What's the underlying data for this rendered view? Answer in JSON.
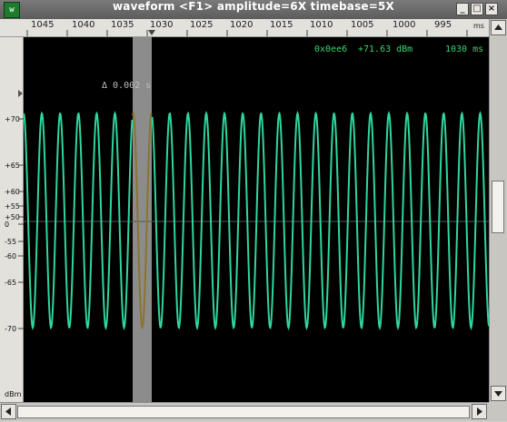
{
  "window": {
    "title": "waveform  <F1> amplitude=6X timebase=5X",
    "app_icon_text": "w"
  },
  "ruler": {
    "ticks": [
      {
        "label": "1045"
      },
      {
        "label": "1040"
      },
      {
        "label": "1035"
      },
      {
        "label": "1030"
      },
      {
        "label": "1025"
      },
      {
        "label": "1020"
      },
      {
        "label": "1015"
      },
      {
        "label": "1010"
      },
      {
        "label": "1005"
      },
      {
        "label": "1000"
      },
      {
        "label": "995"
      }
    ],
    "unit": "ms"
  },
  "yaxis": {
    "labels": [
      "+70",
      "+65",
      "+60",
      "+55",
      "+50",
      "0",
      "-55",
      "-60",
      "-65",
      "-70"
    ],
    "unit": "dBm"
  },
  "readouts": {
    "address": "0x0ee6",
    "level": "+71.63 dBm",
    "time": "1030 ms"
  },
  "delta": {
    "label": "Δ 0.002 s"
  },
  "colors": {
    "wave": "#2fd6a0",
    "wave_selected": "#8a7430",
    "selection": "#8c8c8c",
    "background": "#000000",
    "readout": "#39d36f"
  },
  "icons": {
    "minimize": "_",
    "maximize": "□",
    "close": "×",
    "scroll_up": "▲",
    "scroll_down": "▼",
    "scroll_left": "◀",
    "scroll_right": "▶"
  }
}
